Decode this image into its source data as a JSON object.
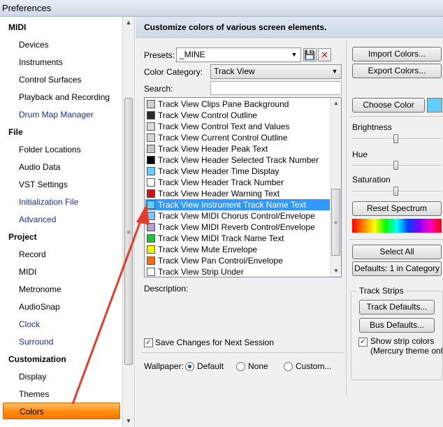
{
  "window": {
    "title": "Preferences"
  },
  "nav": {
    "items": [
      {
        "label": "MIDI",
        "kind": "cat"
      },
      {
        "label": "Devices",
        "kind": "item"
      },
      {
        "label": "Instruments",
        "kind": "item"
      },
      {
        "label": "Control Surfaces",
        "kind": "item"
      },
      {
        "label": "Playback and Recording",
        "kind": "item"
      },
      {
        "label": "Drum Map Manager",
        "kind": "link"
      },
      {
        "label": "File",
        "kind": "cat"
      },
      {
        "label": "Folder Locations",
        "kind": "item"
      },
      {
        "label": "Audio Data",
        "kind": "item"
      },
      {
        "label": "VST Settings",
        "kind": "item"
      },
      {
        "label": "Initialization File",
        "kind": "link"
      },
      {
        "label": "Advanced",
        "kind": "link"
      },
      {
        "label": "Project",
        "kind": "cat"
      },
      {
        "label": "Record",
        "kind": "item"
      },
      {
        "label": "MIDI",
        "kind": "item"
      },
      {
        "label": "Metronome",
        "kind": "item"
      },
      {
        "label": "AudioSnap",
        "kind": "item"
      },
      {
        "label": "Clock",
        "kind": "link"
      },
      {
        "label": "Surround",
        "kind": "link"
      },
      {
        "label": "Customization",
        "kind": "cat"
      },
      {
        "label": "Display",
        "kind": "item"
      },
      {
        "label": "Themes",
        "kind": "item"
      },
      {
        "label": "Colors",
        "kind": "selected"
      }
    ]
  },
  "panel": {
    "header": "Customize colors of various screen elements.",
    "presets_label": "Presets:",
    "presets_value": "_MINE",
    "color_category_label": "Color Category:",
    "color_category_value": "Track View",
    "search_label": "Search:",
    "search_value": "",
    "color_list": [
      {
        "label": "Track View Clips Pane Background",
        "color": "#cfcfcf"
      },
      {
        "label": "Track View Control Outline",
        "color": "#2b2b2b"
      },
      {
        "label": "Track View Control Text and Values",
        "color": "#dcdcdc"
      },
      {
        "label": "Track View Current Control Outline",
        "color": "#d6d6d6"
      },
      {
        "label": "Track View Header Peak Text",
        "color": "#c6c6c6"
      },
      {
        "label": "Track View Header Selected Track Number",
        "color": "#000000"
      },
      {
        "label": "Track View Header Time Display",
        "color": "#5fd0ff"
      },
      {
        "label": "Track View Header Track Number",
        "color": "#ffffff"
      },
      {
        "label": "Track View Header Warning Text",
        "color": "#d01010"
      },
      {
        "label": "Track View Instrument Track Name Text",
        "color": "#5fd0ff",
        "selected": true
      },
      {
        "label": "Track View MIDI Chorus Control/Envelope",
        "color": "#7fc0ff"
      },
      {
        "label": "Track View MIDI Reverb Control/Envelope",
        "color": "#b79bd6"
      },
      {
        "label": "Track View MIDI Track Name Text",
        "color": "#1fbf3f"
      },
      {
        "label": "Track View Mute Envelope",
        "color": "#f4f400"
      },
      {
        "label": "Track View Pan Control/Envelope",
        "color": "#ff6a10"
      },
      {
        "label": "Track View Strip Under",
        "color": "#ffffff"
      }
    ],
    "description_label": "Description:",
    "save_changes_label": "Save Changes for Next Session",
    "save_changes_checked": true,
    "wallpaper_label": "Wallpaper:",
    "wallpaper_options": [
      "Default",
      "None",
      "Custom..."
    ],
    "wallpaper_selected": "Default"
  },
  "right": {
    "import_label": "Import Colors...",
    "export_label": "Export Colors...",
    "choose_color_label": "Choose Color",
    "current_color": "#5fd0ff",
    "brightness_label": "Brightness",
    "hue_label": "Hue",
    "saturation_label": "Saturation",
    "reset_spectrum_label": "Reset Spectrum",
    "select_all_label": "Select All",
    "defaults_label": "Defaults: 1 in Category",
    "track_strips_label": "Track Strips",
    "track_defaults_label": "Track Defaults...",
    "bus_defaults_label": "Bus Defaults...",
    "show_strip_colors_label": "Show strip colors",
    "mercury_note": "(Mercury theme only)",
    "show_strip_colors_checked": true
  },
  "colors": {
    "accent": "#e63c2a",
    "selection": "#3399ff",
    "nav_selected": "#ff8a0e"
  }
}
